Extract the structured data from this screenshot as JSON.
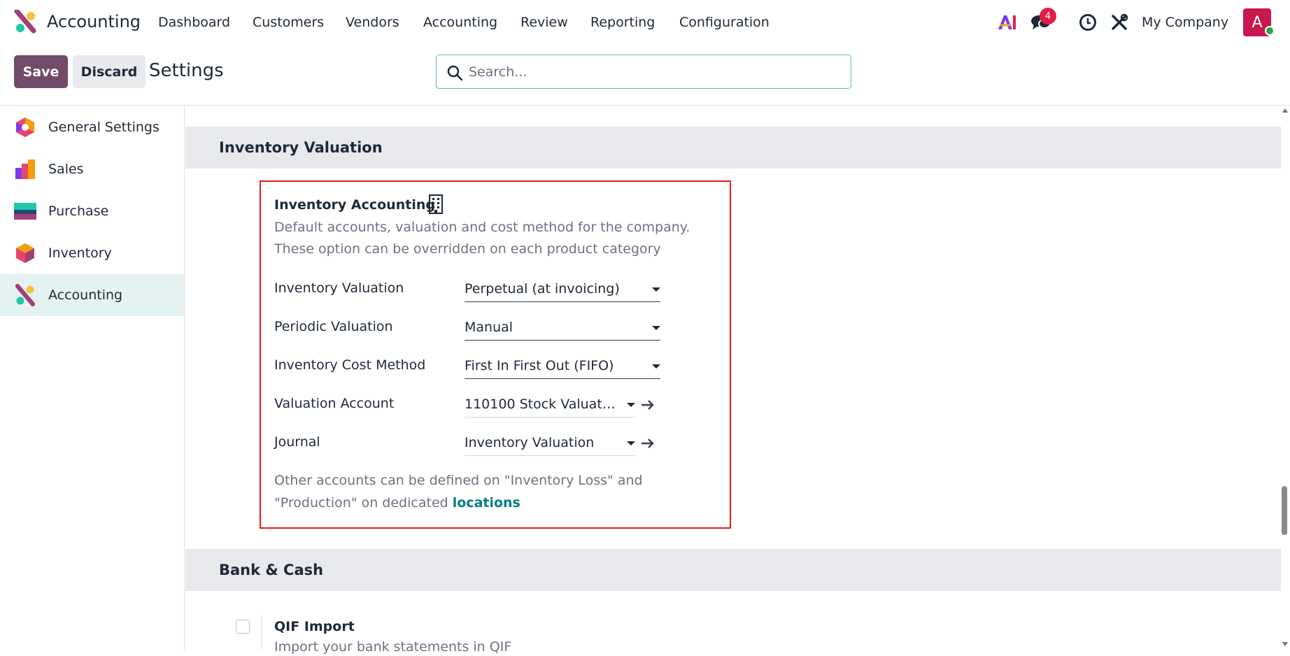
{
  "navbar": {
    "app_title": "Accounting",
    "menu": [
      "Dashboard",
      "Customers",
      "Vendors",
      "Accounting",
      "Review",
      "Reporting",
      "Configuration"
    ],
    "ai_label": "AI",
    "messages_badge": "4",
    "company": "My Company",
    "avatar_letter": "A"
  },
  "control_panel": {
    "save_label": "Save",
    "discard_label": "Discard",
    "title": "Settings",
    "search_placeholder": "Search..."
  },
  "sidebar": {
    "items": [
      {
        "label": "General Settings",
        "icon": "general-settings-icon"
      },
      {
        "label": "Sales",
        "icon": "sales-icon"
      },
      {
        "label": "Purchase",
        "icon": "purchase-icon"
      },
      {
        "label": "Inventory",
        "icon": "inventory-icon"
      },
      {
        "label": "Accounting",
        "icon": "accounting-icon",
        "active": true
      }
    ]
  },
  "sections": {
    "inventory_valuation_title": "Inventory Valuation",
    "bank_cash_title": "Bank & Cash"
  },
  "inventory_accounting": {
    "title": "Inventory Accounting",
    "desc_line1": "Default accounts, valuation and cost method for the company.",
    "desc_line2": "These option can be overridden on each product category",
    "fields": {
      "valuation": {
        "label": "Inventory Valuation",
        "value": "Perpetual (at invoicing)"
      },
      "periodic": {
        "label": "Periodic Valuation",
        "value": "Manual"
      },
      "cost_method": {
        "label": "Inventory Cost Method",
        "value": "First In First Out (FIFO)"
      },
      "valuation_account": {
        "label": "Valuation Account",
        "value": "110100 Stock Valuat…"
      },
      "journal": {
        "label": "Journal",
        "value": "Inventory Valuation"
      }
    },
    "footer_line1": "Other accounts can be defined on \"Inventory Loss\" and",
    "footer_line2_prefix": "\"Production\" on dedicated ",
    "footer_link": "locations"
  },
  "qif": {
    "title": "QIF Import",
    "desc": "Import your bank statements in QIF"
  },
  "colors": {
    "brand": "#714b67",
    "link": "#017e84",
    "highlight_border": "#e11d1d",
    "avatar": "#c8194f",
    "badge": "#e11d48"
  }
}
